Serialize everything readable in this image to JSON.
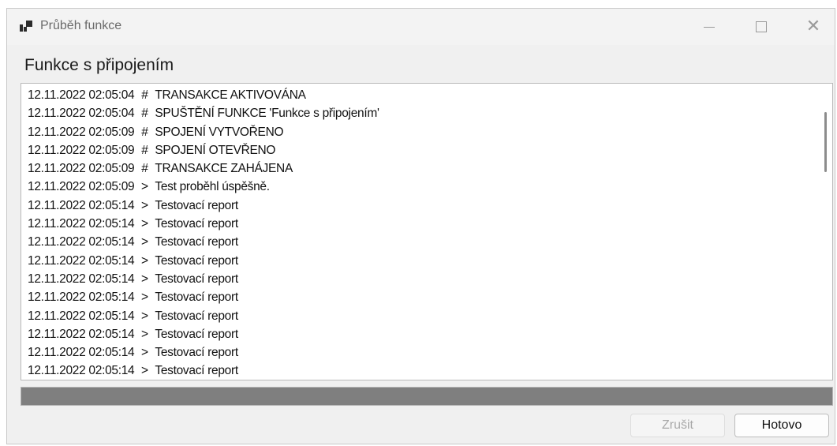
{
  "window": {
    "title": "Průběh funkce"
  },
  "heading": "Funkce s připojením",
  "log": [
    {
      "time": "12.11.2022 02:05:04",
      "marker": "#",
      "text": "TRANSAKCE AKTIVOVÁNA"
    },
    {
      "time": "12.11.2022 02:05:04",
      "marker": "#",
      "text": "SPUŠTĚNÍ FUNKCE 'Funkce s připojením'"
    },
    {
      "time": "12.11.2022 02:05:09",
      "marker": "#",
      "text": "SPOJENÍ VYTVOŘENO"
    },
    {
      "time": "12.11.2022 02:05:09",
      "marker": "#",
      "text": "SPOJENÍ OTEVŘENO"
    },
    {
      "time": "12.11.2022 02:05:09",
      "marker": "#",
      "text": "TRANSAKCE ZAHÁJENA"
    },
    {
      "time": "12.11.2022 02:05:09",
      "marker": ">",
      "text": "Test proběhl úspěšně."
    },
    {
      "time": "12.11.2022 02:05:14",
      "marker": ">",
      "text": "Testovací report"
    },
    {
      "time": "12.11.2022 02:05:14",
      "marker": ">",
      "text": "Testovací report"
    },
    {
      "time": "12.11.2022 02:05:14",
      "marker": ">",
      "text": "Testovací report"
    },
    {
      "time": "12.11.2022 02:05:14",
      "marker": ">",
      "text": "Testovací report"
    },
    {
      "time": "12.11.2022 02:05:14",
      "marker": ">",
      "text": "Testovací report"
    },
    {
      "time": "12.11.2022 02:05:14",
      "marker": ">",
      "text": "Testovací report"
    },
    {
      "time": "12.11.2022 02:05:14",
      "marker": ">",
      "text": "Testovací report"
    },
    {
      "time": "12.11.2022 02:05:14",
      "marker": ">",
      "text": "Testovací report"
    },
    {
      "time": "12.11.2022 02:05:14",
      "marker": ">",
      "text": "Testovací report"
    },
    {
      "time": "12.11.2022 02:05:14",
      "marker": ">",
      "text": "Testovací report"
    }
  ],
  "progress": {
    "value_fraction": 1.0,
    "fill_color": "#7f7f7f"
  },
  "buttons": {
    "cancel_label": "Zrušit",
    "done_label": "Hotovo"
  },
  "icons": {
    "app": "app-window-icon",
    "minimize": "minimize-icon",
    "maximize": "maximize-icon",
    "close": "close-icon"
  }
}
